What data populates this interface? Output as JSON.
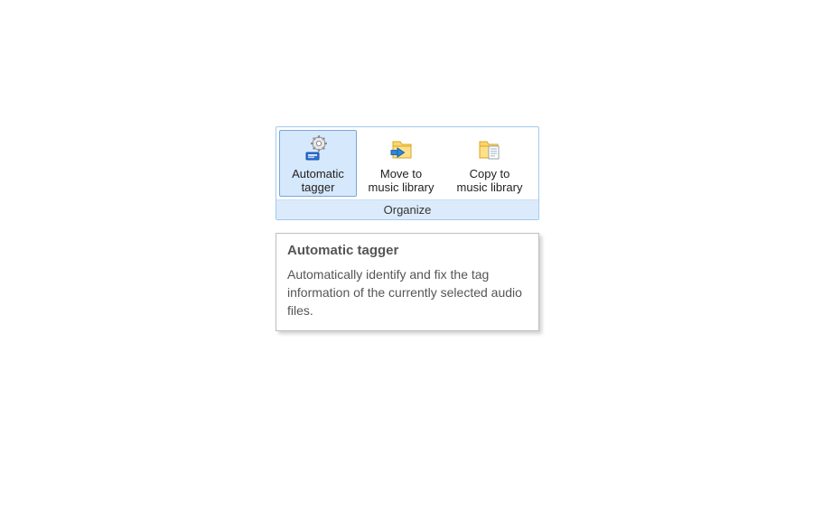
{
  "ribbon": {
    "group_title": "Organize",
    "buttons": [
      {
        "key": "auto_tagger",
        "label": "Automatic\ntagger",
        "selected": true
      },
      {
        "key": "move_library",
        "label": "Move to\nmusic library",
        "selected": false
      },
      {
        "key": "copy_library",
        "label": "Copy to\nmusic library",
        "selected": false
      }
    ]
  },
  "tooltip": {
    "title": "Automatic tagger",
    "body": "Automatically identify and fix the tag information of the currently selected audio files."
  }
}
